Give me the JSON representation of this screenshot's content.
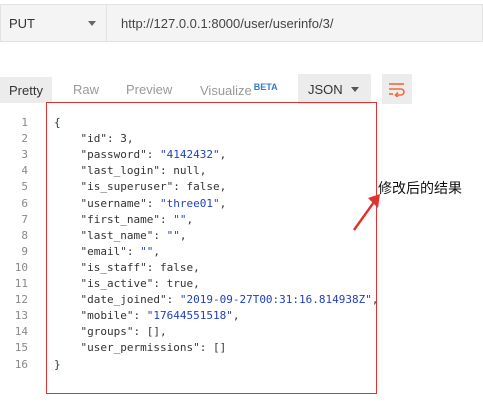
{
  "request": {
    "method": "PUT",
    "url": "http://127.0.0.1:8000/user/userinfo/3/"
  },
  "response_tabs": {
    "pretty": "Pretty",
    "raw": "Raw",
    "preview": "Preview",
    "visualize": "Visualize",
    "visualize_badge": "BETA"
  },
  "format": {
    "selected": "JSON"
  },
  "icons": {
    "wrap": "wrap-lines-icon",
    "method_caret": "chevron-down-icon",
    "format_caret": "chevron-down-icon",
    "arrow": "arrow-icon"
  },
  "colors": {
    "accent": "#f26b3a",
    "annotation_box": "#e0322f",
    "string": "#1f3fc0"
  },
  "annotation": {
    "text": "修改后的结果"
  },
  "code_lines": [
    {
      "n": "1",
      "indent": "",
      "key": "",
      "value": "",
      "text": "{"
    },
    {
      "n": "2",
      "indent": "    ",
      "key": "\"id\"",
      "value": "3",
      "tail": ","
    },
    {
      "n": "3",
      "indent": "    ",
      "key": "\"password\"",
      "value": "\"4142432\"",
      "tail": ","
    },
    {
      "n": "4",
      "indent": "    ",
      "key": "\"last_login\"",
      "value": "null",
      "tail": ","
    },
    {
      "n": "5",
      "indent": "    ",
      "key": "\"is_superuser\"",
      "value": "false",
      "tail": ","
    },
    {
      "n": "6",
      "indent": "    ",
      "key": "\"username\"",
      "value": "\"three01\"",
      "tail": ","
    },
    {
      "n": "7",
      "indent": "    ",
      "key": "\"first_name\"",
      "value": "\"\"",
      "tail": ","
    },
    {
      "n": "8",
      "indent": "    ",
      "key": "\"last_name\"",
      "value": "\"\"",
      "tail": ","
    },
    {
      "n": "9",
      "indent": "    ",
      "key": "\"email\"",
      "value": "\"\"",
      "tail": ","
    },
    {
      "n": "10",
      "indent": "    ",
      "key": "\"is_staff\"",
      "value": "false",
      "tail": ","
    },
    {
      "n": "11",
      "indent": "    ",
      "key": "\"is_active\"",
      "value": "true",
      "tail": ","
    },
    {
      "n": "12",
      "indent": "    ",
      "key": "\"date_joined\"",
      "value": "\"2019-09-27T00:31:16.814938Z\"",
      "tail": ","
    },
    {
      "n": "13",
      "indent": "    ",
      "key": "\"mobile\"",
      "value": "\"17644551518\"",
      "tail": ","
    },
    {
      "n": "14",
      "indent": "    ",
      "key": "\"groups\"",
      "value": "[]",
      "tail": ","
    },
    {
      "n": "15",
      "indent": "    ",
      "key": "\"user_permissions\"",
      "value": "[]",
      "tail": ""
    },
    {
      "n": "16",
      "indent": "",
      "key": "",
      "value": "",
      "text": "}"
    }
  ]
}
